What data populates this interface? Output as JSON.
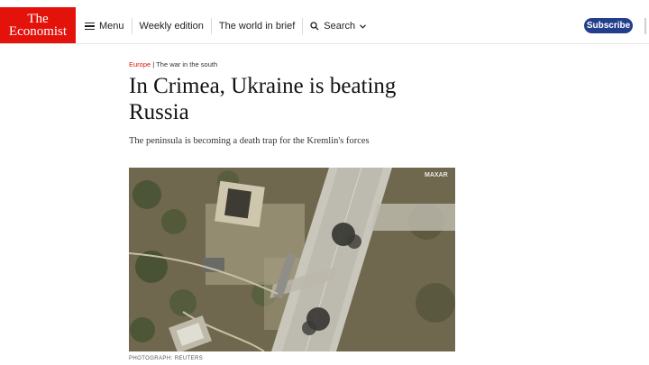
{
  "header": {
    "logo_line1": "The",
    "logo_line2": "Economist",
    "menu_label": "Menu",
    "weekly_label": "Weekly edition",
    "world_label": "The world in brief",
    "search_label": "Search",
    "subscribe_label": "Subscribe"
  },
  "article": {
    "section": "Europe",
    "subsection": "The war in the south",
    "headline": "In Crimea, Ukraine is beating Russia",
    "subheadline": "The peninsula is becoming a death trap for the Kremlin's forces",
    "image_watermark": "MAXAR",
    "photo_credit": "PHOTOGRAPH: REUTERS"
  },
  "colors": {
    "brand_red": "#e3120b",
    "subscribe_blue": "#233e8b"
  },
  "icons": [
    "menu-icon",
    "search-icon",
    "chevron-down-icon"
  ]
}
